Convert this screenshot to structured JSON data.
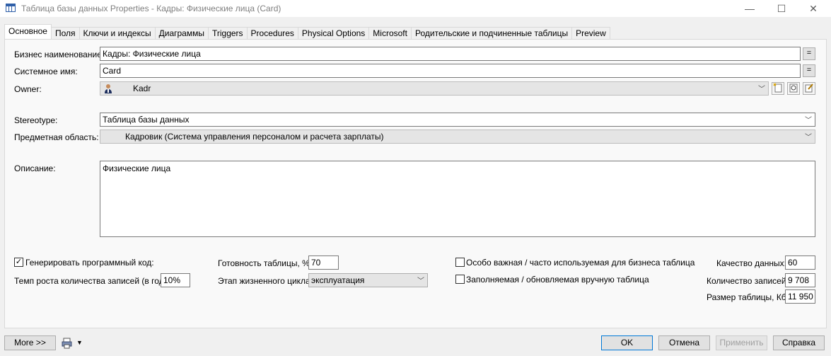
{
  "window": {
    "title": "Таблица базы данных Properties - Кадры: Физические лица (Card)",
    "minimize": "—",
    "maximize": "☐",
    "close": "✕"
  },
  "tabs": [
    {
      "label": "Основное",
      "active": true
    },
    {
      "label": "Поля"
    },
    {
      "label": "Ключи и индексы"
    },
    {
      "label": "Диаграммы"
    },
    {
      "label": "Triggers"
    },
    {
      "label": "Procedures"
    },
    {
      "label": "Physical Options"
    },
    {
      "label": "Microsoft"
    },
    {
      "label": "Родительские и подчиненные таблицы"
    },
    {
      "label": "Preview"
    }
  ],
  "general": {
    "business_name_label": "Бизнес наименование:",
    "business_name": "Кадры: Физические лица",
    "system_name_label": "Системное имя:",
    "system_name": "Card",
    "eq_label": "=",
    "owner_label": "Owner:",
    "owner": "Kadr",
    "stereotype_label": "Stereotype:",
    "stereotype": "Таблица базы данных",
    "subject_area_label": "Предметная область:",
    "subject_area": "Кадровик (Система управления персоналом и расчета зарплаты)",
    "description_label": "Описание:",
    "description": "Физические лица"
  },
  "options": {
    "generate_code_label": "Генерировать программный код:",
    "generate_code_checked": true,
    "growth_rate_label": "Темп роста количества записей (в год):",
    "growth_rate": "10%",
    "readiness_label": "Готовность таблицы, %:",
    "readiness": "70",
    "lifecycle_label": "Этап жизненного цикла:",
    "lifecycle": "эксплуатация",
    "important_label": "Особо важная / часто используемая для бизнеса таблица",
    "important_checked": false,
    "manual_label": "Заполняемая / обновляемая вручную таблица",
    "manual_checked": false,
    "data_quality_label": "Качество данных:",
    "data_quality": "60",
    "record_count_label": "Количество записей:",
    "record_count": "9 708",
    "table_size_label": "Размер таблицы, Кб:",
    "table_size": "11 950"
  },
  "buttons": {
    "more": "More >>",
    "ok": "OK",
    "cancel": "Отмена",
    "apply": "Применить",
    "help": "Справка"
  }
}
